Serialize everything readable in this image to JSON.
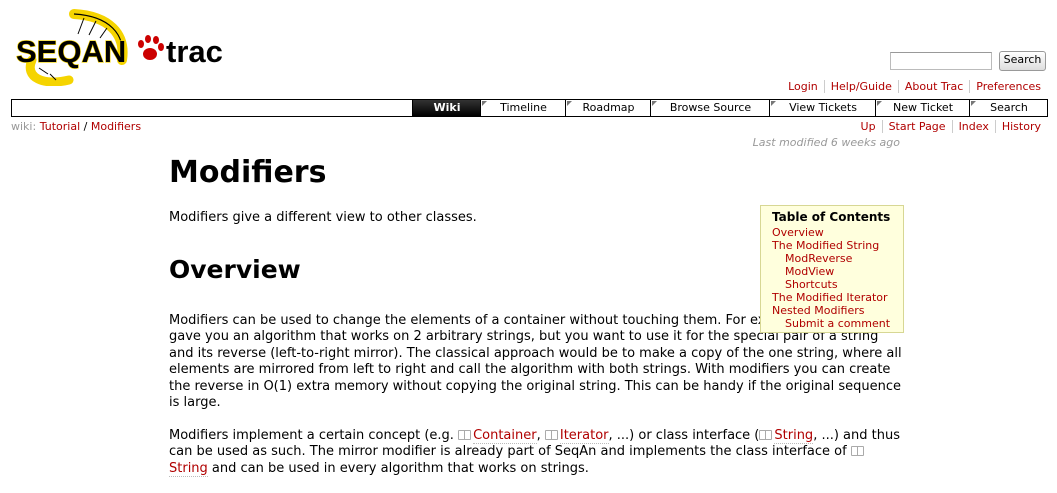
{
  "brand": {
    "logo_left": "SEQAN",
    "logo_right": "trac"
  },
  "search": {
    "value": "",
    "button_label": "Search"
  },
  "metanav": [
    "Login",
    "Help/Guide",
    "About Trac",
    "Preferences"
  ],
  "mainnav": {
    "tabs": [
      {
        "label": "Wiki",
        "active": true
      },
      {
        "label": "Timeline",
        "active": false
      },
      {
        "label": "Roadmap",
        "active": false
      },
      {
        "label": "Browse Source",
        "active": false
      },
      {
        "label": "View Tickets",
        "active": false
      },
      {
        "label": "New Ticket",
        "active": false
      },
      {
        "label": "Search",
        "active": false
      }
    ]
  },
  "breadcrumb": {
    "prefix": "wiki:",
    "parent": "Tutorial",
    "separator": " / ",
    "current": "Modifiers"
  },
  "ctxnav": [
    "Up",
    "Start Page",
    "Index",
    "History"
  ],
  "last_modified": "Last modified 6 weeks ago",
  "page": {
    "title": "Modifiers",
    "intro": "Modifiers give a different view to other classes.",
    "overview_heading": "Overview",
    "overview_text": "Modifiers can be used to change the elements of a container without touching them. For example, someone gave you an algorithm that works on 2 arbitrary strings, but you want to use it for the special pair of a string and its reverse (left-to-right mirror). The classical approach would be to make a copy of the one string, where all elements are mirrored from left to right and call the algorithm with both strings. With modifiers you can create the reverse in O(1) extra memory without copying the original string. This can be handy if the original sequence is large.",
    "para2": {
      "t1": "Modifiers implement a certain concept (e.g. ",
      "link1": "Container",
      "t2": ", ",
      "link2": "Iterator",
      "t3": ", ...) or class interface (",
      "link3": "String",
      "t4": ", ...) and thus can be used as such. The mirror modifier is already part of SeqAn and implements the class interface of ",
      "link4": "String",
      "t5": " and can be used in every algorithm that works on strings."
    }
  },
  "toc": {
    "title": "Table of Contents",
    "items": [
      {
        "label": "Overview",
        "level": 1
      },
      {
        "label": "The Modified String",
        "level": 1
      },
      {
        "label": "ModReverse",
        "level": 2
      },
      {
        "label": "ModView",
        "level": 2
      },
      {
        "label": "Shortcuts",
        "level": 2
      },
      {
        "label": "The Modified Iterator",
        "level": 1
      },
      {
        "label": "Nested Modifiers",
        "level": 1
      },
      {
        "label": "Submit a comment",
        "level": 2
      }
    ]
  },
  "colors": {
    "link": "#b00000",
    "toc_bg": "#ffffdd",
    "logo_yellow": "#f5d400",
    "logo_black": "#000000",
    "logo_red": "#cc0000"
  }
}
